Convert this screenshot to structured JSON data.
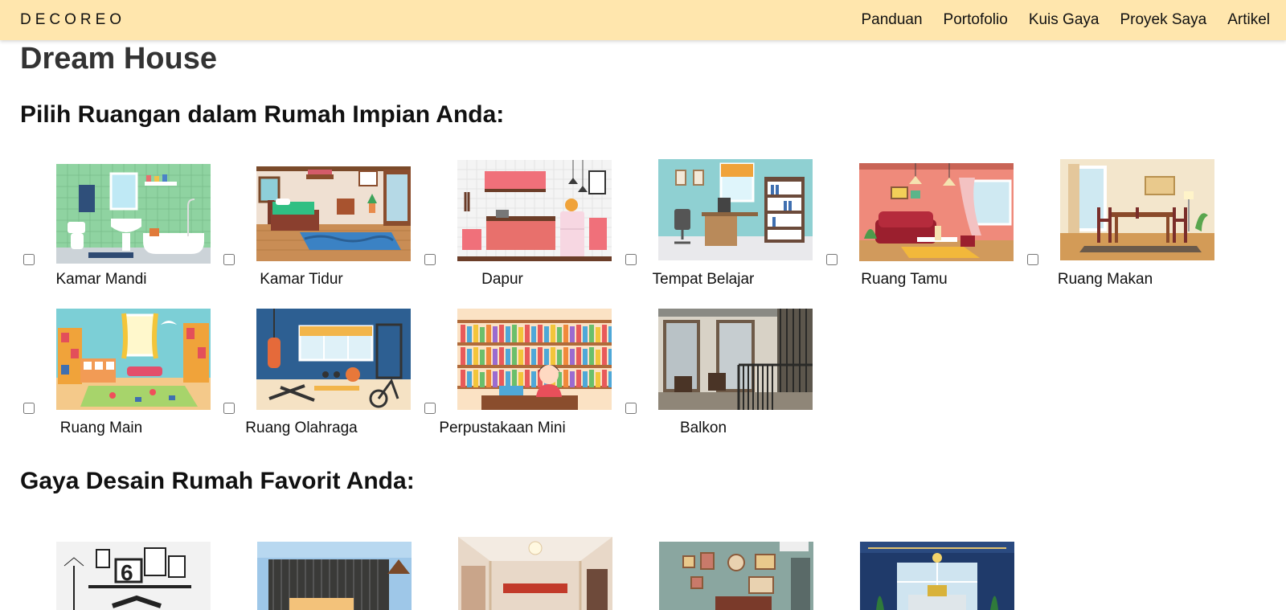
{
  "brand": "DECOREO",
  "nav": [
    "Panduan",
    "Portofolio",
    "Kuis Gaya",
    "Proyek Saya",
    "Artikel"
  ],
  "page_title": "Dream House",
  "rooms_section": {
    "title": "Pilih Ruangan dalam Rumah Impian Anda:",
    "rooms": [
      {
        "label": "Kamar Mandi",
        "checked": false
      },
      {
        "label": "Kamar Tidur",
        "checked": false
      },
      {
        "label": "Dapur",
        "checked": false
      },
      {
        "label": "Tempat Belajar",
        "checked": false
      },
      {
        "label": "Ruang Tamu",
        "checked": false
      },
      {
        "label": "Ruang Makan",
        "checked": false
      },
      {
        "label": "Ruang Main",
        "checked": false
      },
      {
        "label": "Ruang Olahraga",
        "checked": false
      },
      {
        "label": "Perpustakaan Mini",
        "checked": false
      },
      {
        "label": "Balkon",
        "checked": false
      }
    ]
  },
  "styles_section": {
    "title": "Gaya Desain Rumah Favorit Anda:"
  }
}
